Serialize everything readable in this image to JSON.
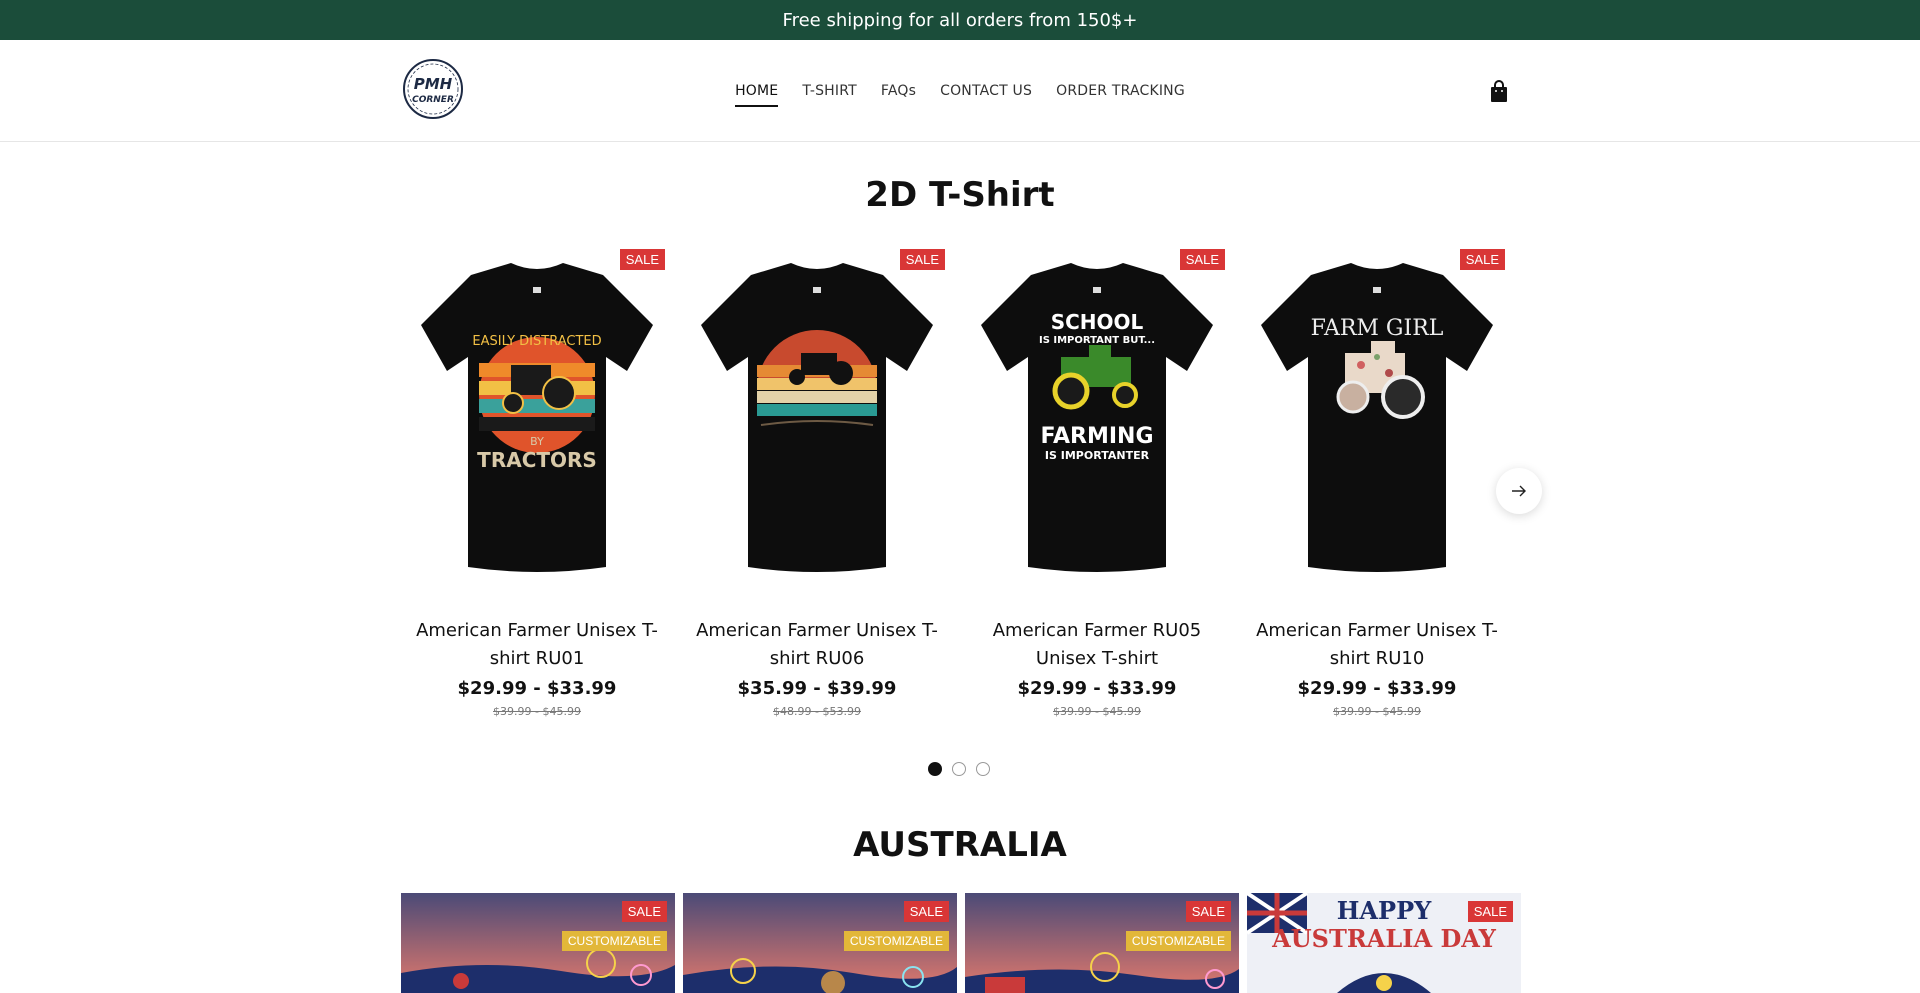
{
  "announcement": "Free shipping for all orders from 150$+",
  "header": {
    "logo_text_line1": "PMH",
    "logo_text_line2": "CORNER",
    "nav": [
      "HOME",
      "T-SHIRT",
      "FAQs",
      "CONTACT US",
      "ORDER TRACKING"
    ],
    "active_nav": "HOME"
  },
  "section1": {
    "title": "2D T-Shirt",
    "products": [
      {
        "title": "American Farmer Unisex T-shirt RU01",
        "price": "$29.99 - $33.99",
        "compare": "$39.99 - $45.99",
        "badge": "SALE",
        "design": "Easily Distracted By Tractors"
      },
      {
        "title": "American Farmer Unisex T-shirt RU06",
        "price": "$35.99 - $39.99",
        "compare": "$48.99 - $53.99",
        "badge": "SALE",
        "design": "Tractor Sunset"
      },
      {
        "title": "American Farmer RU05 Unisex T-shirt",
        "price": "$29.99 - $33.99",
        "compare": "$39.99 - $45.99",
        "badge": "SALE",
        "design": "School Is Important But Farming Is Importanter"
      },
      {
        "title": "American Farmer Unisex T-shirt RU10",
        "price": "$29.99 - $33.99",
        "compare": "$39.99 - $45.99",
        "badge": "SALE",
        "design": "Farm Girl"
      }
    ],
    "dots": 3,
    "active_dot": 0
  },
  "shirt_text": {
    "p1_top": "EASILY DISTRACTED",
    "p1_by": "BY",
    "p1_bottom": "TRACTORS",
    "p3_a": "SCHOOL",
    "p3_b": "IS IMPORTANT BUT...",
    "p3_c": "FARMING",
    "p3_d": "IS IMPORTANTER",
    "p4_a": "FARM GIRL"
  },
  "section2": {
    "title": "AUSTRALIA",
    "cards": [
      {
        "badge": "SALE",
        "badge2": "CUSTOMIZABLE"
      },
      {
        "badge": "SALE",
        "badge2": "CUSTOMIZABLE"
      },
      {
        "badge": "SALE",
        "badge2": "CUSTOMIZABLE"
      },
      {
        "badge": "SALE",
        "banner_line1": "HAPPY",
        "banner_line2": "AUSTRALIA DAY"
      }
    ]
  },
  "colors": {
    "announcement_bg": "#1b4d3a",
    "sale_badge": "#d93636",
    "customizable_badge": "#e2b739"
  }
}
